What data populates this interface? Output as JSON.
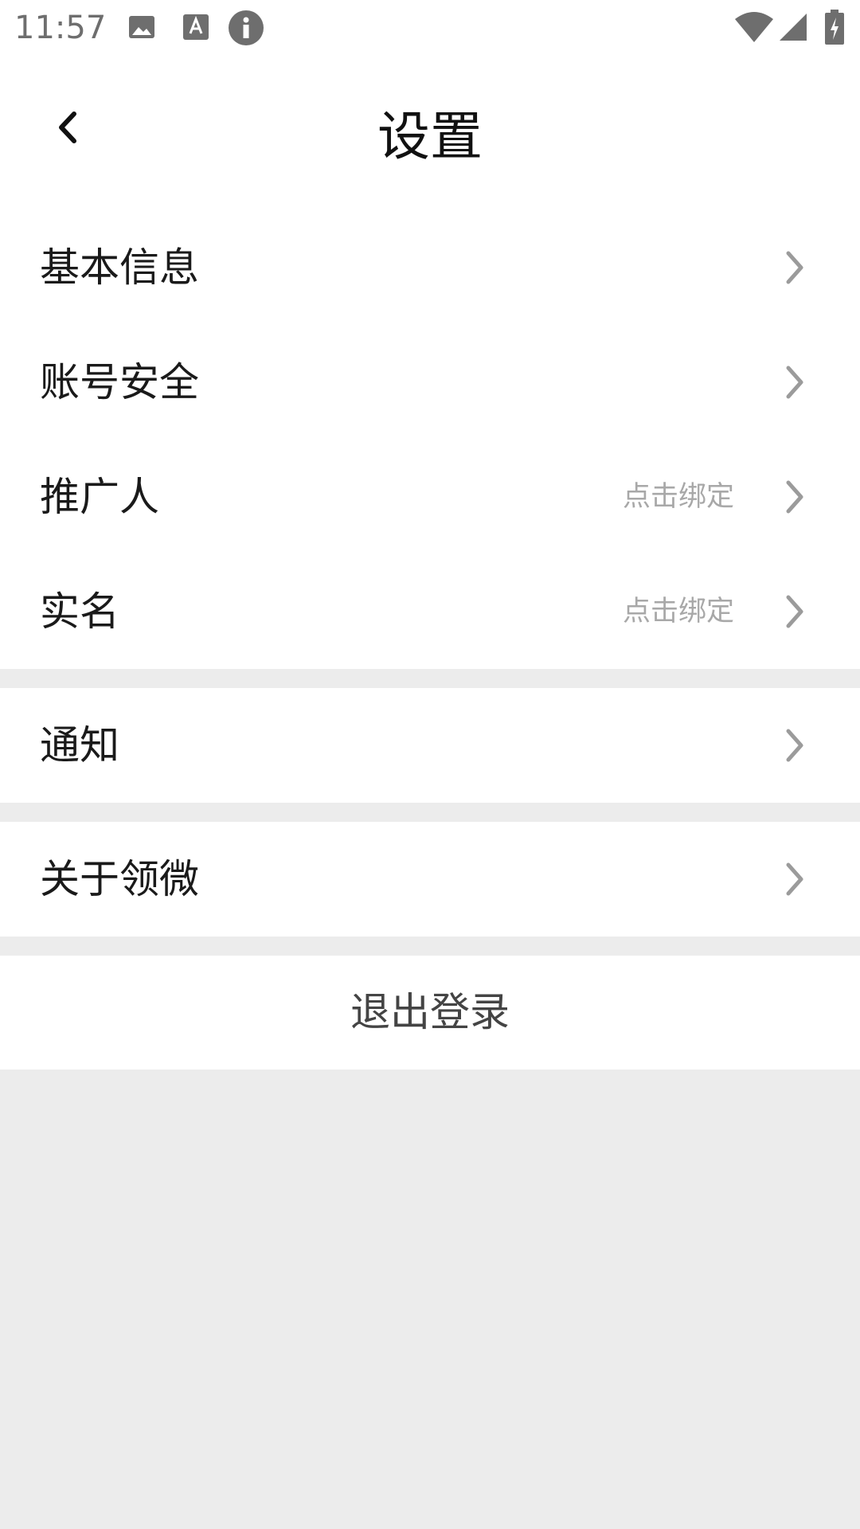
{
  "status_bar": {
    "time": "11:57"
  },
  "header": {
    "title": "设置",
    "back_icon": "chevron-left-icon"
  },
  "settings": {
    "items": [
      {
        "label": "基本信息",
        "hint": ""
      },
      {
        "label": "账号安全",
        "hint": ""
      },
      {
        "label": "推广人",
        "hint": "点击绑定"
      },
      {
        "label": "实名",
        "hint": "点击绑定"
      },
      {
        "label": "通知",
        "hint": ""
      },
      {
        "label": "关于领微",
        "hint": ""
      }
    ]
  },
  "logout": {
    "label": "退出登录"
  },
  "colors": {
    "background": "#ececec",
    "card": "#ffffff",
    "text": "#1a1a1a",
    "hint": "#a8a8a8",
    "chevron": "#9b9b9b"
  }
}
